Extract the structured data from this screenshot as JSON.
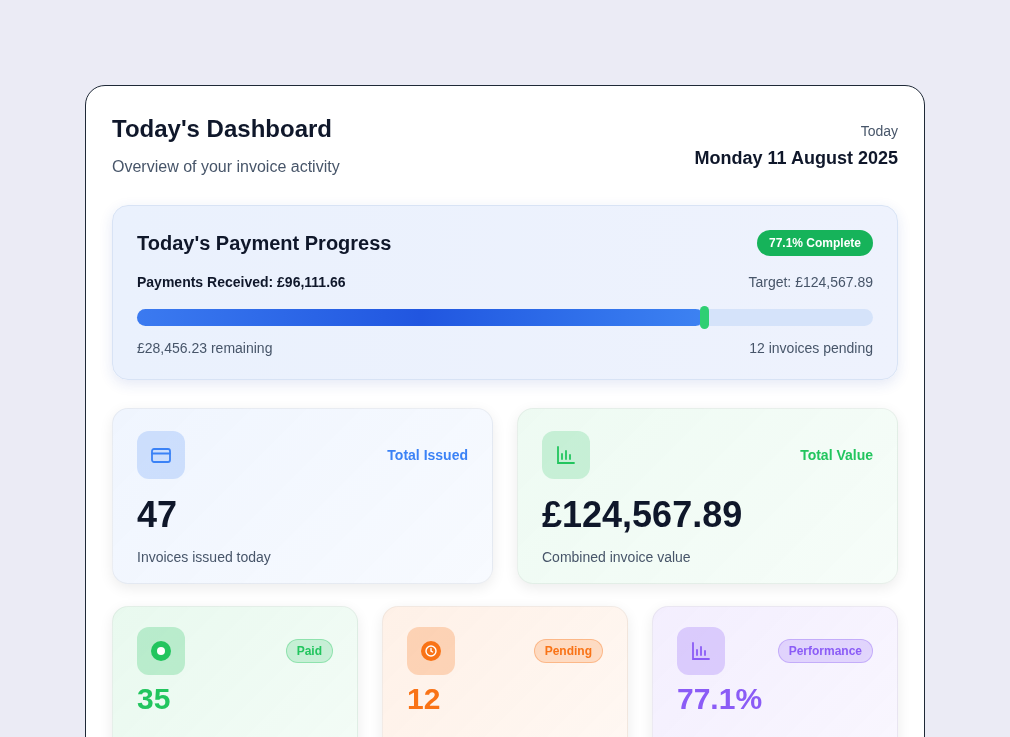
{
  "header": {
    "title": "Today's Dashboard",
    "subtitle": "Overview of your invoice activity",
    "date_label": "Today",
    "date": "Monday 11 August 2025"
  },
  "progress": {
    "title": "Today's Payment Progress",
    "badge": "77.1% Complete",
    "received": "Payments Received: £96,111.66",
    "target": "Target: £124,567.89",
    "level": 0.771,
    "remaining": "£28,456.23 remaining",
    "pending": "12 invoices pending"
  },
  "summary_cards": [
    {
      "label": "Total Issued",
      "value": "47",
      "caption": "Invoices issued today",
      "color": "#3b82f6"
    },
    {
      "label": "Total Value",
      "value": "£124,567.89",
      "caption": "Combined invoice value",
      "color": "#22c55e"
    }
  ],
  "status_cards": [
    {
      "label": "Paid",
      "value": "35",
      "color": "#22c55e"
    },
    {
      "label": "Pending",
      "value": "12",
      "color": "#f97316"
    },
    {
      "label": "Performance",
      "value": "77.1%",
      "color": "#8b5cf6"
    }
  ]
}
